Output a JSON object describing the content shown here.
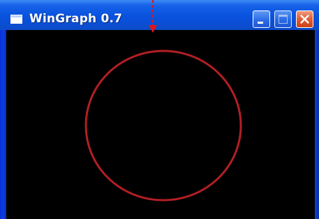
{
  "window": {
    "title": "WinGraph 0.7"
  },
  "canvas": {
    "background": "#000000",
    "shape": "circle",
    "stroke_color": "#b21f24"
  },
  "annotation": {
    "arrow_color": "#e0151b"
  },
  "icons": {
    "app": "window-icon",
    "minimize": "minimize-icon",
    "maximize": "maximize-icon",
    "close": "close-icon"
  }
}
